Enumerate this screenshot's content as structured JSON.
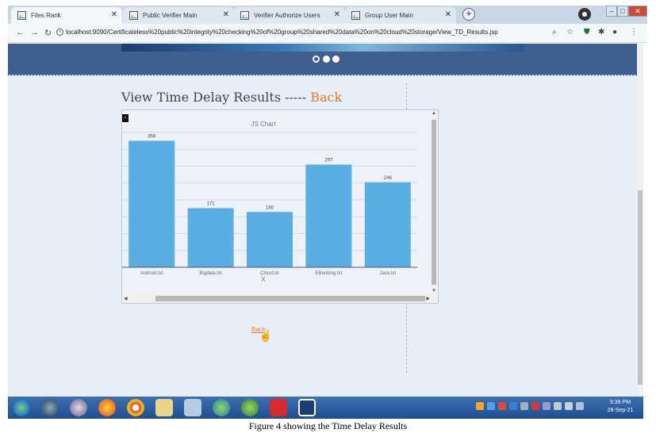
{
  "browser": {
    "tabs": [
      {
        "title": "Files Rank",
        "active": true
      },
      {
        "title": "Public Verifier Main",
        "active": false
      },
      {
        "title": "Verifier Authorize Users",
        "active": false
      },
      {
        "title": "Group User Main",
        "active": false
      }
    ],
    "new_tab_label": "+",
    "url": "localhost:9090/Certificateless%20public%20integrity%20checking%20of%20group%20shared%20data%20on%20cloud%20storage/View_TD_Results.jsp"
  },
  "page": {
    "heading": "View Time Delay Results  -----",
    "heading_back": "Back",
    "back_link": "Back"
  },
  "chart_data": {
    "type": "bar",
    "title": "JS Chart",
    "xlabel": "X",
    "ylabel": "",
    "categories": [
      "Android.txt",
      "Bigdata.txt",
      "Cloud.txt",
      "EBanking.txt",
      "Java.txt"
    ],
    "values": [
      366,
      171,
      160,
      297,
      246
    ],
    "ylim": [
      0,
      390
    ],
    "grid": true,
    "bar_color": "#5aaee3"
  },
  "taskbar": {
    "clock_time": "5:39 PM",
    "clock_date": "28-Sep-21"
  },
  "caption": "Figure 4 showing the Time Delay Results"
}
